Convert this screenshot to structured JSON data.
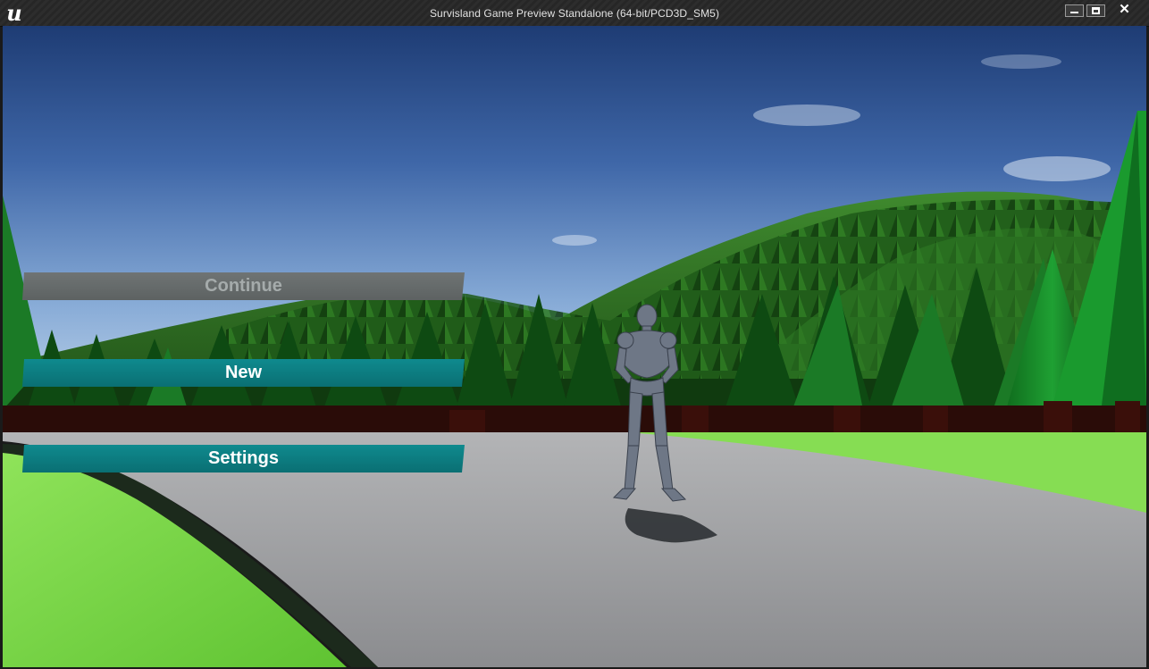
{
  "window": {
    "title": "Survisland Game Preview Standalone (64-bit/PCD3D_SM5)",
    "logo_icon": "unreal-engine-logo",
    "logo_glyph": "u",
    "close_glyph": "✕"
  },
  "menu": {
    "continue_label": "Continue",
    "new_label": "New",
    "settings_label": "Settings"
  },
  "colors": {
    "button_teal": "#0f8a8e",
    "button_disabled": "#6f7474",
    "sky_top": "#1d3f7a",
    "sky_horizon": "#b7cfe8",
    "grass": "#7cd84a",
    "road": "#9a9b9e"
  }
}
